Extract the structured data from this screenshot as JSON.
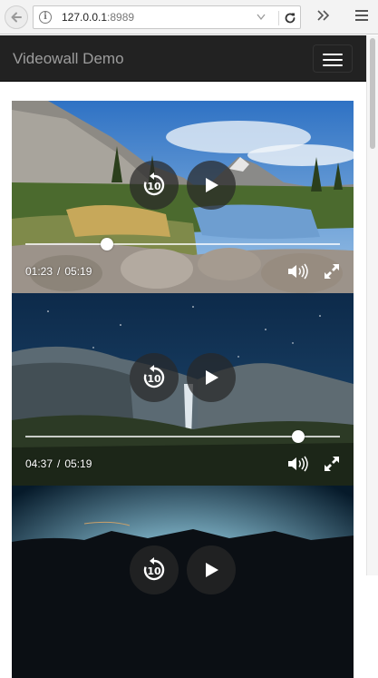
{
  "browser": {
    "url_host": "127.0.0.1",
    "url_port": ":8989"
  },
  "navbar": {
    "brand": "Videowall Demo"
  },
  "videos": [
    {
      "current_time": "01:23",
      "separator": "/",
      "duration": "05:19",
      "progress": 0.26
    },
    {
      "current_time": "04:37",
      "separator": "/",
      "duration": "05:19",
      "progress": 0.868
    },
    {
      "current_time": "",
      "separator": "",
      "duration": "",
      "progress": null
    }
  ],
  "colors": {
    "navbar_bg": "#222222",
    "brand_text": "#9d9d9d",
    "control_bg": "rgba(40,40,40,0.72)"
  },
  "icons": {
    "back": "back-arrow-icon",
    "info": "info-icon",
    "reload": "reload-icon",
    "overflow": "overflow-chevrons-icon",
    "menu": "hamburger-menu-icon",
    "replay": "replay-10-icon",
    "play": "play-icon",
    "volume": "volume-icon",
    "fullscreen": "fullscreen-icon"
  }
}
